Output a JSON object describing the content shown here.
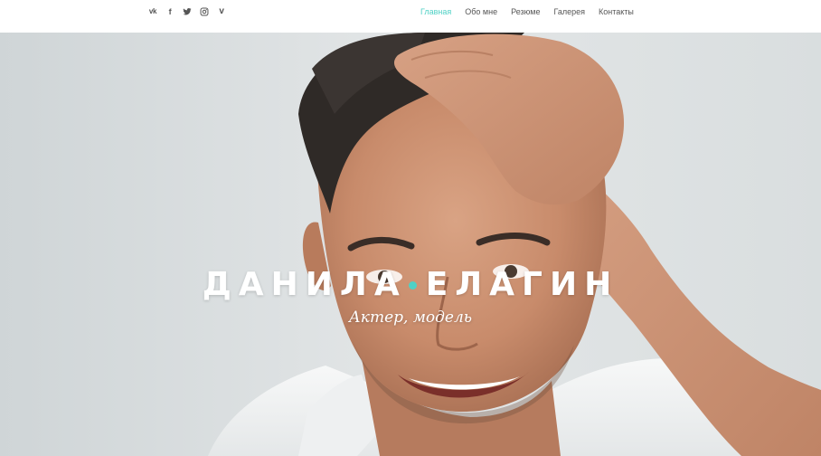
{
  "social": [
    {
      "icon": "vk-icon",
      "text": "vk"
    },
    {
      "icon": "facebook-icon",
      "text": "f"
    },
    {
      "icon": "twitter-icon",
      "text": ""
    },
    {
      "icon": "instagram-icon",
      "text": ""
    },
    {
      "icon": "vimeo-icon",
      "text": "v"
    }
  ],
  "nav": {
    "items": [
      {
        "label": "Главная",
        "active": true
      },
      {
        "label": "Обо мне",
        "active": false
      },
      {
        "label": "Резюме",
        "active": false
      },
      {
        "label": "Галерея",
        "active": false
      },
      {
        "label": "Контакты",
        "active": false
      }
    ]
  },
  "hero": {
    "name_first": "ДАНИЛА",
    "name_last": "ЕЛАГИН",
    "subtitle": "Актер, модель"
  },
  "colors": {
    "accent": "#4fd1c5",
    "nav_text": "#555555",
    "hero_background": "#dfe3e4",
    "text_on_photo": "#ffffff"
  }
}
